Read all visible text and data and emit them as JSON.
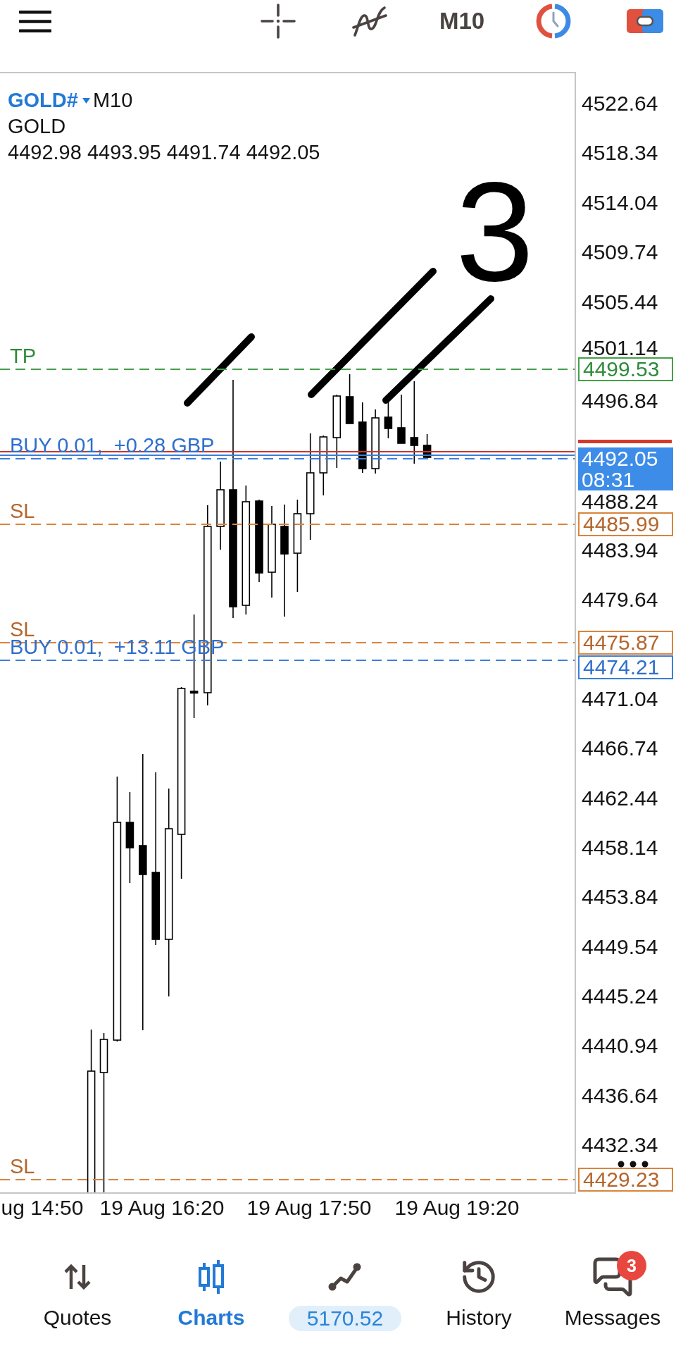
{
  "toolbar": {
    "timeframe": "M10"
  },
  "chart": {
    "symbol": "GOLD#",
    "timeframe": "M10",
    "description": "GOLD",
    "ohlc": "4492.98 4493.95 4491.74 4492.05",
    "levels": [
      {
        "kind": "tp",
        "label": "TP",
        "price": "4499.53"
      },
      {
        "kind": "position",
        "label": "BUY 0.01,  +0.28 GBP"
      },
      {
        "kind": "sl",
        "label": "SL",
        "price": "4485.99"
      },
      {
        "kind": "sl",
        "label": "SL",
        "price": "4475.87"
      },
      {
        "kind": "position",
        "label": "BUY 0.01,  +13.11 GBP",
        "price": "4474.21"
      },
      {
        "kind": "sl",
        "label": "SL",
        "price": "4429.23"
      }
    ],
    "current_price": {
      "price": "4492.05",
      "countdown": "08:31"
    },
    "price_axis": [
      "4522.64",
      "4518.34",
      "4514.04",
      "4509.74",
      "4505.44",
      "4501.14",
      "4496.84",
      "4488.24",
      "4483.94",
      "4479.64",
      "4471.04",
      "4466.74",
      "4462.44",
      "4458.14",
      "4453.84",
      "4449.54",
      "4445.24",
      "4440.94",
      "4436.64",
      "4432.34"
    ],
    "time_axis": [
      "ug 14:50",
      "19 Aug 16:20",
      "19 Aug 17:50",
      "19 Aug 19:20"
    ],
    "annotation": "3"
  },
  "nav": {
    "tabs": [
      {
        "kind": "tab",
        "label": "Quotes",
        "selected": false
      },
      {
        "kind": "tab",
        "label": "Charts",
        "selected": true
      },
      {
        "kind": "pill",
        "label": "5170.52",
        "selected": false
      },
      {
        "kind": "tab",
        "label": "History",
        "selected": false
      },
      {
        "kind": "tab",
        "label": "Messages",
        "selected": false,
        "badge": "3"
      }
    ]
  }
}
